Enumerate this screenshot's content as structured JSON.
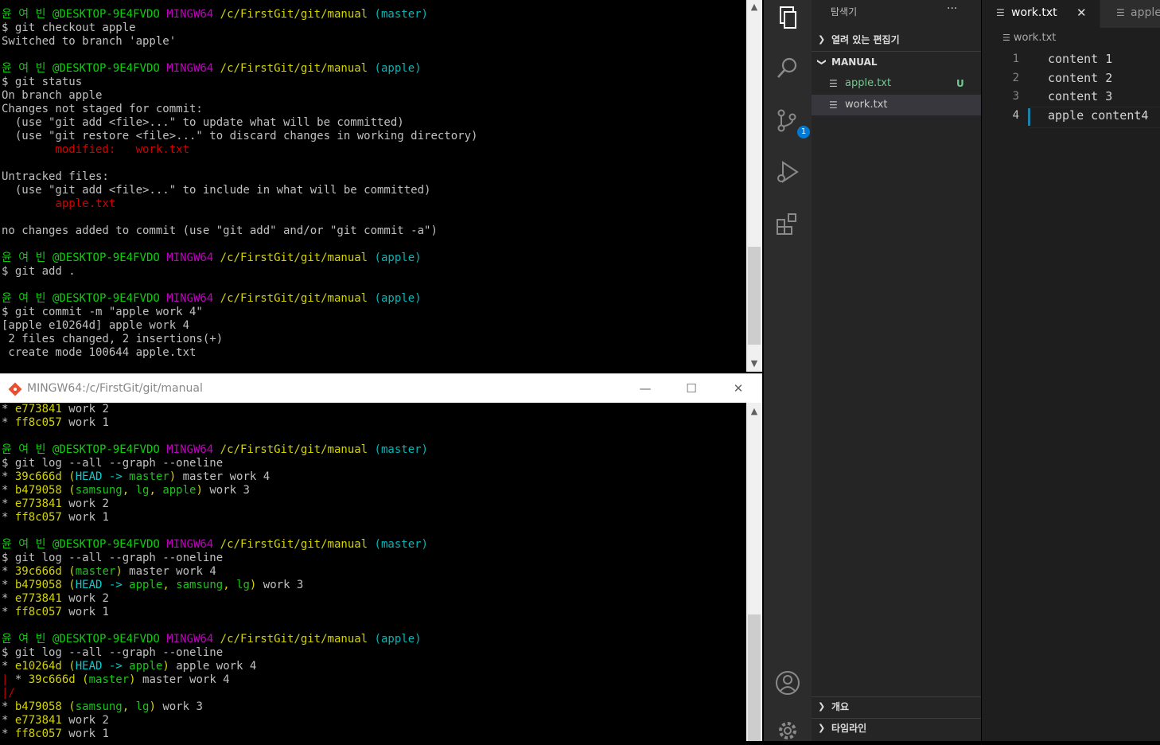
{
  "top_terminal": {
    "lines": [
      [
        {
          "t": "윤 여 빈 ",
          "c": "g"
        },
        {
          "t": "@DESKTOP-9E4FVDO ",
          "c": "g"
        },
        {
          "t": "MINGW64 ",
          "c": "m"
        },
        {
          "t": "/c/FirstGit/git/manual ",
          "c": "y"
        },
        {
          "t": "(master)",
          "c": "c"
        }
      ],
      [
        {
          "t": "$ git checkout apple",
          "c": ""
        }
      ],
      [
        {
          "t": "Switched to branch 'apple'",
          "c": ""
        }
      ],
      [
        {
          "t": "",
          "c": ""
        }
      ],
      [
        {
          "t": "윤 여 빈 ",
          "c": "g"
        },
        {
          "t": "@DESKTOP-9E4FVDO ",
          "c": "g"
        },
        {
          "t": "MINGW64 ",
          "c": "m"
        },
        {
          "t": "/c/FirstGit/git/manual ",
          "c": "y"
        },
        {
          "t": "(apple)",
          "c": "c"
        }
      ],
      [
        {
          "t": "$ git status",
          "c": ""
        }
      ],
      [
        {
          "t": "On branch apple",
          "c": ""
        }
      ],
      [
        {
          "t": "Changes not staged for commit:",
          "c": ""
        }
      ],
      [
        {
          "t": "  (use \"git add <file>...\" to update what will be committed)",
          "c": ""
        }
      ],
      [
        {
          "t": "  (use \"git restore <file>...\" to discard changes in working directory)",
          "c": ""
        }
      ],
      [
        {
          "t": "        modified:   work.txt",
          "c": "r"
        }
      ],
      [
        {
          "t": "",
          "c": ""
        }
      ],
      [
        {
          "t": "Untracked files:",
          "c": ""
        }
      ],
      [
        {
          "t": "  (use \"git add <file>...\" to include in what will be committed)",
          "c": ""
        }
      ],
      [
        {
          "t": "        apple.txt",
          "c": "r"
        }
      ],
      [
        {
          "t": "",
          "c": ""
        }
      ],
      [
        {
          "t": "no changes added to commit (use \"git add\" and/or \"git commit -a\")",
          "c": ""
        }
      ],
      [
        {
          "t": "",
          "c": ""
        }
      ],
      [
        {
          "t": "윤 여 빈 ",
          "c": "g"
        },
        {
          "t": "@DESKTOP-9E4FVDO ",
          "c": "g"
        },
        {
          "t": "MINGW64 ",
          "c": "m"
        },
        {
          "t": "/c/FirstGit/git/manual ",
          "c": "y"
        },
        {
          "t": "(apple)",
          "c": "c"
        }
      ],
      [
        {
          "t": "$ git add .",
          "c": ""
        }
      ],
      [
        {
          "t": "",
          "c": ""
        }
      ],
      [
        {
          "t": "윤 여 빈 ",
          "c": "g"
        },
        {
          "t": "@DESKTOP-9E4FVDO ",
          "c": "g"
        },
        {
          "t": "MINGW64 ",
          "c": "m"
        },
        {
          "t": "/c/FirstGit/git/manual ",
          "c": "y"
        },
        {
          "t": "(apple)",
          "c": "c"
        }
      ],
      [
        {
          "t": "$ git commit -m \"apple work 4\"",
          "c": ""
        }
      ],
      [
        {
          "t": "[apple e10264d] apple work 4",
          "c": ""
        }
      ],
      [
        {
          "t": " 2 files changed, 2 insertions(+)",
          "c": ""
        }
      ],
      [
        {
          "t": " create mode 100644 apple.txt",
          "c": ""
        }
      ]
    ]
  },
  "bottom_window": {
    "title": "MINGW64:/c/FirstGit/git/manual",
    "minimize": "—",
    "maximize": "☐",
    "close": "✕"
  },
  "bottom_terminal": {
    "lines": [
      [
        {
          "t": "* ",
          "c": ""
        },
        {
          "t": "e773841",
          "c": "y"
        },
        {
          "t": " work 2",
          "c": ""
        }
      ],
      [
        {
          "t": "* ",
          "c": ""
        },
        {
          "t": "ff8c057",
          "c": "y"
        },
        {
          "t": " work 1",
          "c": ""
        }
      ],
      [
        {
          "t": "",
          "c": ""
        }
      ],
      [
        {
          "t": "윤 여 빈 ",
          "c": "g"
        },
        {
          "t": "@DESKTOP-9E4FVDO ",
          "c": "g"
        },
        {
          "t": "MINGW64 ",
          "c": "m"
        },
        {
          "t": "/c/FirstGit/git/manual ",
          "c": "y"
        },
        {
          "t": "(master)",
          "c": "c"
        }
      ],
      [
        {
          "t": "$ git log --all --graph --oneline",
          "c": ""
        }
      ],
      [
        {
          "t": "* ",
          "c": ""
        },
        {
          "t": "39c666d",
          "c": "y"
        },
        {
          "t": " (",
          "c": "y"
        },
        {
          "t": "HEAD -> ",
          "c": "h"
        },
        {
          "t": "master",
          "c": "gr"
        },
        {
          "t": ")",
          "c": "y"
        },
        {
          "t": " master work 4",
          "c": ""
        }
      ],
      [
        {
          "t": "* ",
          "c": ""
        },
        {
          "t": "b479058",
          "c": "y"
        },
        {
          "t": " (",
          "c": "y"
        },
        {
          "t": "samsung",
          "c": "gr"
        },
        {
          "t": ", ",
          "c": "y"
        },
        {
          "t": "lg",
          "c": "gr"
        },
        {
          "t": ", ",
          "c": "y"
        },
        {
          "t": "apple",
          "c": "gr"
        },
        {
          "t": ")",
          "c": "y"
        },
        {
          "t": " work 3",
          "c": ""
        }
      ],
      [
        {
          "t": "* ",
          "c": ""
        },
        {
          "t": "e773841",
          "c": "y"
        },
        {
          "t": " work 2",
          "c": ""
        }
      ],
      [
        {
          "t": "* ",
          "c": ""
        },
        {
          "t": "ff8c057",
          "c": "y"
        },
        {
          "t": " work 1",
          "c": ""
        }
      ],
      [
        {
          "t": "",
          "c": ""
        }
      ],
      [
        {
          "t": "윤 여 빈 ",
          "c": "g"
        },
        {
          "t": "@DESKTOP-9E4FVDO ",
          "c": "g"
        },
        {
          "t": "MINGW64 ",
          "c": "m"
        },
        {
          "t": "/c/FirstGit/git/manual ",
          "c": "y"
        },
        {
          "t": "(master)",
          "c": "c"
        }
      ],
      [
        {
          "t": "$ git log --all --graph --oneline",
          "c": ""
        }
      ],
      [
        {
          "t": "* ",
          "c": ""
        },
        {
          "t": "39c666d",
          "c": "y"
        },
        {
          "t": " (",
          "c": "y"
        },
        {
          "t": "master",
          "c": "gr"
        },
        {
          "t": ")",
          "c": "y"
        },
        {
          "t": " master work 4",
          "c": ""
        }
      ],
      [
        {
          "t": "* ",
          "c": ""
        },
        {
          "t": "b479058",
          "c": "y"
        },
        {
          "t": " (",
          "c": "y"
        },
        {
          "t": "HEAD -> ",
          "c": "h"
        },
        {
          "t": "apple",
          "c": "gr"
        },
        {
          "t": ", ",
          "c": "y"
        },
        {
          "t": "samsung",
          "c": "gr"
        },
        {
          "t": ", ",
          "c": "y"
        },
        {
          "t": "lg",
          "c": "gr"
        },
        {
          "t": ")",
          "c": "y"
        },
        {
          "t": " work 3",
          "c": ""
        }
      ],
      [
        {
          "t": "* ",
          "c": ""
        },
        {
          "t": "e773841",
          "c": "y"
        },
        {
          "t": " work 2",
          "c": ""
        }
      ],
      [
        {
          "t": "* ",
          "c": ""
        },
        {
          "t": "ff8c057",
          "c": "y"
        },
        {
          "t": " work 1",
          "c": ""
        }
      ],
      [
        {
          "t": "",
          "c": ""
        }
      ],
      [
        {
          "t": "윤 여 빈 ",
          "c": "g"
        },
        {
          "t": "@DESKTOP-9E4FVDO ",
          "c": "g"
        },
        {
          "t": "MINGW64 ",
          "c": "m"
        },
        {
          "t": "/c/FirstGit/git/manual ",
          "c": "y"
        },
        {
          "t": "(apple)",
          "c": "c"
        }
      ],
      [
        {
          "t": "$ git log --all --graph --oneline",
          "c": ""
        }
      ],
      [
        {
          "t": "* ",
          "c": ""
        },
        {
          "t": "e10264d",
          "c": "y"
        },
        {
          "t": " (",
          "c": "y"
        },
        {
          "t": "HEAD -> ",
          "c": "h"
        },
        {
          "t": "apple",
          "c": "gr"
        },
        {
          "t": ")",
          "c": "y"
        },
        {
          "t": " apple work 4",
          "c": ""
        }
      ],
      [
        {
          "t": "| ",
          "c": "r"
        },
        {
          "t": "* ",
          "c": ""
        },
        {
          "t": "39c666d",
          "c": "y"
        },
        {
          "t": " (",
          "c": "y"
        },
        {
          "t": "master",
          "c": "gr"
        },
        {
          "t": ")",
          "c": "y"
        },
        {
          "t": " master work 4",
          "c": ""
        }
      ],
      [
        {
          "t": "|/",
          "c": "r"
        }
      ],
      [
        {
          "t": "* ",
          "c": ""
        },
        {
          "t": "b479058",
          "c": "y"
        },
        {
          "t": " (",
          "c": "y"
        },
        {
          "t": "samsung",
          "c": "gr"
        },
        {
          "t": ", ",
          "c": "y"
        },
        {
          "t": "lg",
          "c": "gr"
        },
        {
          "t": ")",
          "c": "y"
        },
        {
          "t": " work 3",
          "c": ""
        }
      ],
      [
        {
          "t": "* ",
          "c": ""
        },
        {
          "t": "e773841",
          "c": "y"
        },
        {
          "t": " work 2",
          "c": ""
        }
      ],
      [
        {
          "t": "* ",
          "c": ""
        },
        {
          "t": "ff8c057",
          "c": "y"
        },
        {
          "t": " work 1",
          "c": ""
        }
      ]
    ]
  },
  "vscode": {
    "explorer_title": "탐색기",
    "more": "···",
    "open_editors": "열려 있는 편집기",
    "folder": "MANUAL",
    "files": [
      {
        "name": "apple.txt",
        "status": "U"
      },
      {
        "name": "work.txt",
        "status": ""
      }
    ],
    "outline": "개요",
    "timeline": "타임라인",
    "scm_badge": "1",
    "tabs": [
      {
        "label": "work.txt",
        "close": "✕"
      },
      {
        "label": "apple"
      }
    ],
    "breadcrumb": "work.txt",
    "line_numbers": [
      "1",
      "2",
      "3",
      "4"
    ],
    "code_lines": [
      "content 1",
      "content 2",
      "content 3",
      "apple content4"
    ]
  },
  "colors": {
    "prompt_user": "#0ad00a",
    "prompt_mingw": "#c000c0",
    "prompt_path": "#d4d400",
    "prompt_branch": "#00b6b6",
    "error_red": "#d00000",
    "untracked_green": "#73c991"
  }
}
